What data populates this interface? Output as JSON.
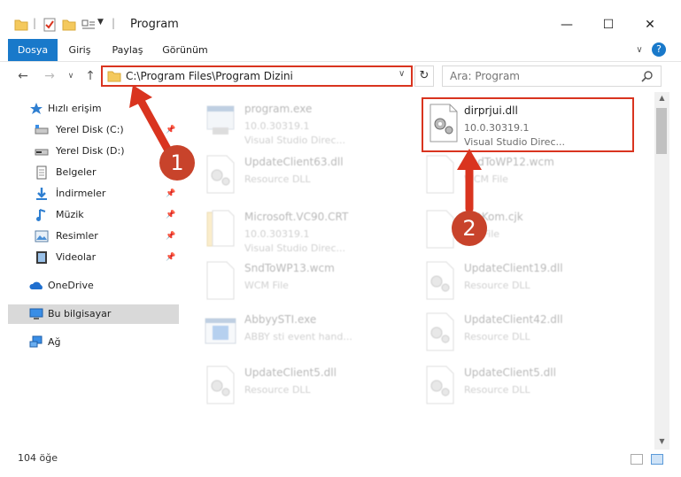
{
  "window": {
    "title": "Program",
    "controls": {
      "minimize": "—",
      "maximize": "☐",
      "close": "✕"
    }
  },
  "ribbon": {
    "tabs": [
      "Dosya",
      "Giriş",
      "Paylaş",
      "Görünüm"
    ],
    "help": "?"
  },
  "addressbar": {
    "path": "C:\\Program Files\\Program Dizini",
    "search_placeholder": "Ara: Program"
  },
  "sidebar": {
    "items": [
      {
        "label": "Hızlı erişim",
        "icon": "star-icon",
        "pinned": false
      },
      {
        "label": "Yerel Disk (C:)",
        "icon": "drive-icon",
        "pinned": true
      },
      {
        "label": "Yerel Disk (D:)",
        "icon": "drive-icon",
        "pinned": false
      },
      {
        "label": "Belgeler",
        "icon": "documents-icon",
        "pinned": true
      },
      {
        "label": "İndirmeler",
        "icon": "download-icon",
        "pinned": true
      },
      {
        "label": "Müzik",
        "icon": "music-icon",
        "pinned": true
      },
      {
        "label": "Resimler",
        "icon": "pictures-icon",
        "pinned": true
      },
      {
        "label": "Videolar",
        "icon": "videos-icon",
        "pinned": true
      },
      {
        "label": "OneDrive",
        "icon": "onedrive-icon",
        "pinned": false
      },
      {
        "label": "Bu bilgisayar",
        "icon": "computer-icon",
        "pinned": false
      },
      {
        "label": "Ağ",
        "icon": "network-icon",
        "pinned": false
      }
    ]
  },
  "files": [
    {
      "name": "program.exe",
      "line2": "10.0.30319.1",
      "line3": "Visual Studio Direc...",
      "icon": "exe-icon",
      "faded": true
    },
    {
      "name": "dirprjui.dll",
      "line2": "10.0.30319.1",
      "line3": "Visual Studio Direc...",
      "icon": "dll-gear-icon",
      "faded": false,
      "highlight": true
    },
    {
      "name": "UpdateClient63.dll",
      "line2": "Resource DLL",
      "line3": "",
      "icon": "dll-gear-icon",
      "faded": true
    },
    {
      "name": "SndToWP12.wcm",
      "line2": "WCM File",
      "line3": "",
      "icon": "blank-file-icon",
      "faded": true
    },
    {
      "name": "Microsoft.VC90.CRT",
      "line2": "10.0.30319.1",
      "line3": "Visual Studio Direc...",
      "icon": "folder-file-icon",
      "faded": true
    },
    {
      "name": "SetKom.cjk",
      "line2": "CJK File",
      "line3": "",
      "icon": "blank-file-icon",
      "faded": true
    },
    {
      "name": "SndToWP13.wcm",
      "line2": "WCM File",
      "line3": "",
      "icon": "blank-file-icon",
      "faded": true
    },
    {
      "name": "UpdateClient19.dll",
      "line2": "Resource DLL",
      "line3": "",
      "icon": "dll-gear-icon",
      "faded": true
    },
    {
      "name": "AbbyySTI.exe",
      "line2": "ABBY sti event hand...",
      "line3": "",
      "icon": "app-window-icon",
      "faded": true
    },
    {
      "name": "UpdateClient42.dll",
      "line2": "Resource DLL",
      "line3": "",
      "icon": "dll-gear-icon",
      "faded": true
    },
    {
      "name": "UpdateClient5.dll",
      "line2": "Resource DLL",
      "line3": "",
      "icon": "dll-gear-icon",
      "faded": true
    },
    {
      "name": "UpdateClient5.dll",
      "line2": "Resource DLL",
      "line3": "",
      "icon": "dll-gear-icon",
      "faded": true
    }
  ],
  "status": {
    "item_count": "104 öğe"
  },
  "annotations": {
    "callout1": "1",
    "callout2": "2",
    "color": "#c8432b"
  }
}
